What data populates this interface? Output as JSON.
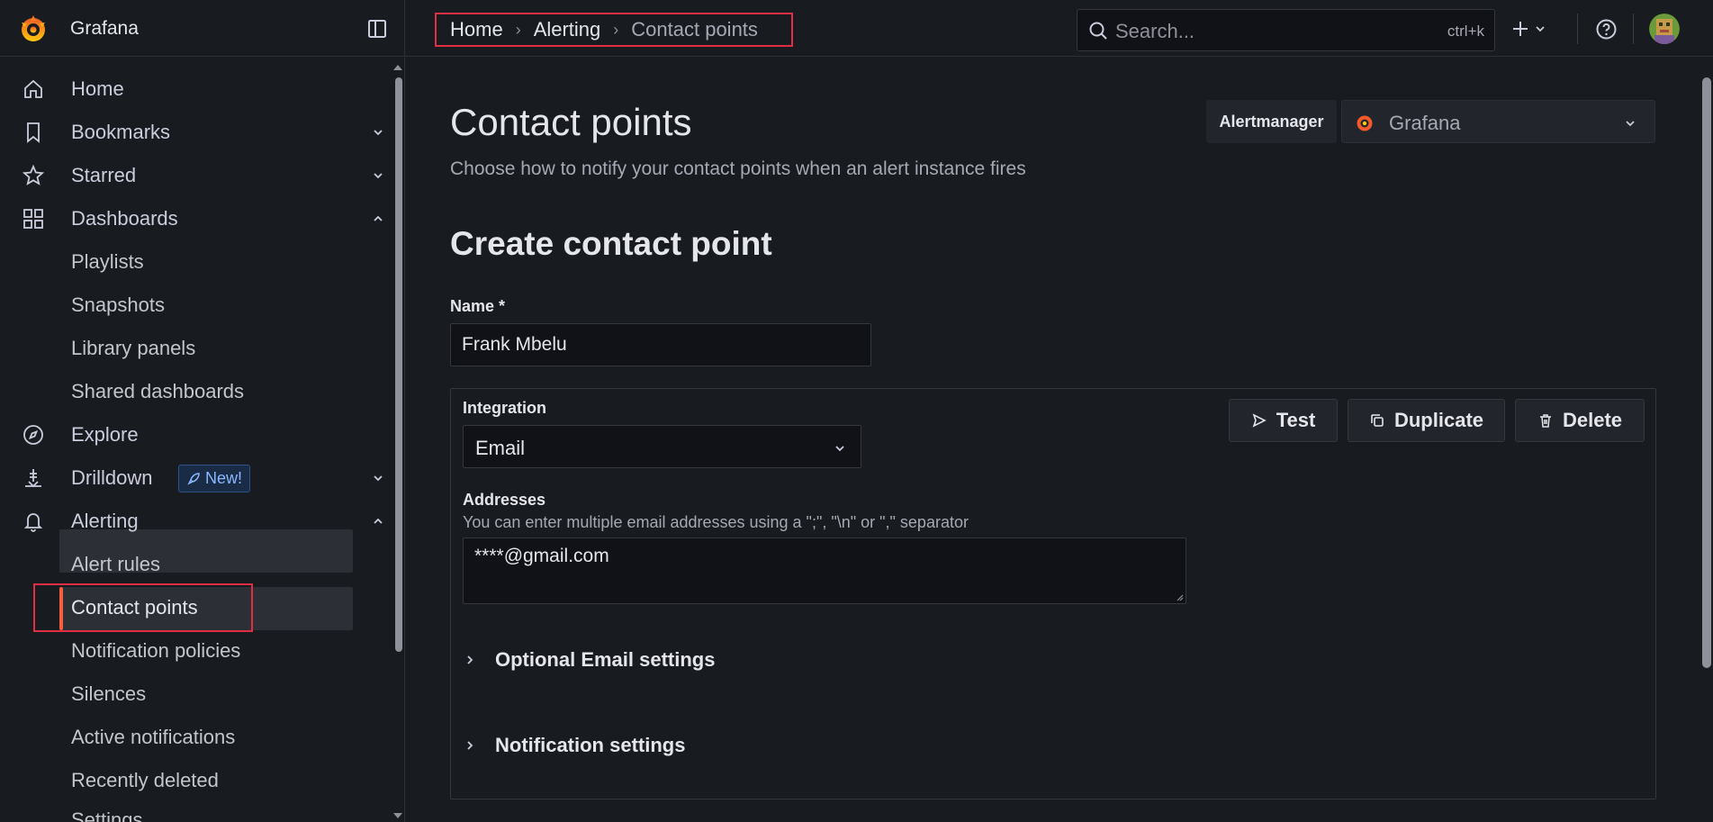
{
  "brand": {
    "name": "Grafana"
  },
  "breadcrumb": [
    "Home",
    "Alerting",
    "Contact points"
  ],
  "search": {
    "placeholder": "Search...",
    "shortcut": "ctrl+k"
  },
  "sidebar": {
    "items": [
      {
        "label": "Home",
        "icon": "home-icon"
      },
      {
        "label": "Bookmarks",
        "icon": "bookmark-icon",
        "expand": "down"
      },
      {
        "label": "Starred",
        "icon": "star-icon",
        "expand": "down"
      },
      {
        "label": "Dashboards",
        "icon": "apps-icon",
        "expand": "up"
      },
      {
        "label": "Playlists"
      },
      {
        "label": "Snapshots"
      },
      {
        "label": "Library panels"
      },
      {
        "label": "Shared dashboards"
      },
      {
        "label": "Explore",
        "icon": "compass-icon"
      },
      {
        "label": "Drilldown",
        "icon": "drilldown-icon",
        "expand": "down",
        "badge": "New!"
      },
      {
        "label": "Alerting",
        "icon": "bell-icon",
        "expand": "up"
      },
      {
        "label": "Alert rules"
      },
      {
        "label": "Contact points",
        "active": true
      },
      {
        "label": "Notification policies"
      },
      {
        "label": "Silences"
      },
      {
        "label": "Active notifications"
      },
      {
        "label": "Recently deleted"
      },
      {
        "label": "Settings"
      }
    ]
  },
  "page": {
    "title": "Contact points",
    "subtitle": "Choose how to notify your contact points when an alert instance fires",
    "alertmanager_label": "Alertmanager",
    "alertmanager_value": "Grafana",
    "section_title": "Create contact point"
  },
  "form": {
    "name_label": "Name *",
    "name_value": "Frank Mbelu",
    "integration_label": "Integration",
    "integration_value": "Email",
    "addresses_label": "Addresses",
    "addresses_help": "You can enter multiple email addresses using a \";\", \"\\n\" or \",\" separator",
    "addresses_value": "****@gmail.com",
    "optional_settings": "Optional Email settings",
    "notification_settings": "Notification settings",
    "buttons": {
      "test": "Test",
      "duplicate": "Duplicate",
      "delete": "Delete"
    }
  },
  "colors": {
    "accent": "#f55f3e",
    "highlight_box": "#e02f44",
    "badge": "#8ab8ff"
  }
}
